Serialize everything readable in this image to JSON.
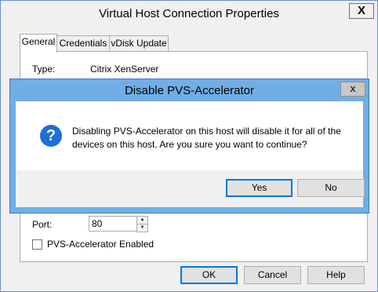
{
  "parent_window": {
    "title": "Virtual Host Connection Properties",
    "close_glyph": "X",
    "tabs": [
      {
        "label": "General",
        "active": true
      },
      {
        "label": "Credentials",
        "active": false
      },
      {
        "label": "vDisk Update",
        "active": false
      }
    ],
    "type_label": "Type:",
    "type_value": "Citrix XenServer",
    "port_label": "Port:",
    "port_value": "80",
    "spin_up_glyph": "▲",
    "spin_down_glyph": "▼",
    "pvs_checkbox_label": "PVS-Accelerator Enabled",
    "pvs_checkbox_checked": false,
    "buttons": {
      "ok": "OK",
      "cancel": "Cancel",
      "help": "Help"
    }
  },
  "dialog": {
    "title": "Disable PVS-Accelerator",
    "close_glyph": "x",
    "icon": "question-icon",
    "icon_glyph": "?",
    "message_line1": "Disabling PVS-Accelerator on this host will disable it for all of the",
    "message_line2": "devices on this host. Are you sure you want to continue?",
    "buttons": {
      "yes": "Yes",
      "no": "No"
    }
  },
  "colors": {
    "dialog_frame": "#70aee5",
    "accent": "#0078d7",
    "question_icon": "#1f6fd6"
  }
}
